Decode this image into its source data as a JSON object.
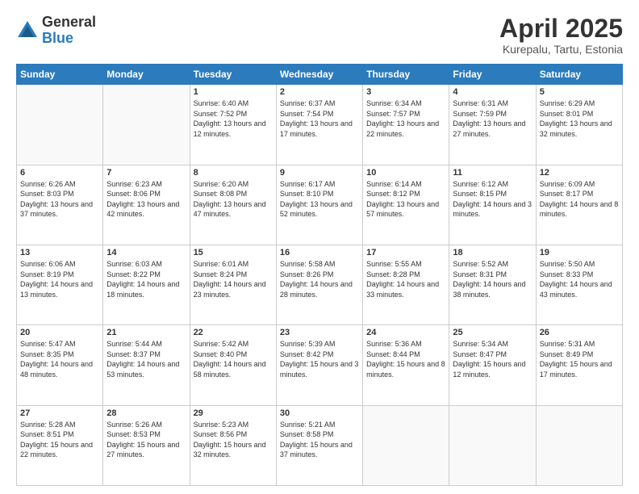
{
  "logo": {
    "general": "General",
    "blue": "Blue"
  },
  "title": "April 2025",
  "location": "Kurepalu, Tartu, Estonia",
  "days_of_week": [
    "Sunday",
    "Monday",
    "Tuesday",
    "Wednesday",
    "Thursday",
    "Friday",
    "Saturday"
  ],
  "weeks": [
    [
      {
        "day": "",
        "info": ""
      },
      {
        "day": "",
        "info": ""
      },
      {
        "day": "1",
        "info": "Sunrise: 6:40 AM\nSunset: 7:52 PM\nDaylight: 13 hours and 12 minutes."
      },
      {
        "day": "2",
        "info": "Sunrise: 6:37 AM\nSunset: 7:54 PM\nDaylight: 13 hours and 17 minutes."
      },
      {
        "day": "3",
        "info": "Sunrise: 6:34 AM\nSunset: 7:57 PM\nDaylight: 13 hours and 22 minutes."
      },
      {
        "day": "4",
        "info": "Sunrise: 6:31 AM\nSunset: 7:59 PM\nDaylight: 13 hours and 27 minutes."
      },
      {
        "day": "5",
        "info": "Sunrise: 6:29 AM\nSunset: 8:01 PM\nDaylight: 13 hours and 32 minutes."
      }
    ],
    [
      {
        "day": "6",
        "info": "Sunrise: 6:26 AM\nSunset: 8:03 PM\nDaylight: 13 hours and 37 minutes."
      },
      {
        "day": "7",
        "info": "Sunrise: 6:23 AM\nSunset: 8:06 PM\nDaylight: 13 hours and 42 minutes."
      },
      {
        "day": "8",
        "info": "Sunrise: 6:20 AM\nSunset: 8:08 PM\nDaylight: 13 hours and 47 minutes."
      },
      {
        "day": "9",
        "info": "Sunrise: 6:17 AM\nSunset: 8:10 PM\nDaylight: 13 hours and 52 minutes."
      },
      {
        "day": "10",
        "info": "Sunrise: 6:14 AM\nSunset: 8:12 PM\nDaylight: 13 hours and 57 minutes."
      },
      {
        "day": "11",
        "info": "Sunrise: 6:12 AM\nSunset: 8:15 PM\nDaylight: 14 hours and 3 minutes."
      },
      {
        "day": "12",
        "info": "Sunrise: 6:09 AM\nSunset: 8:17 PM\nDaylight: 14 hours and 8 minutes."
      }
    ],
    [
      {
        "day": "13",
        "info": "Sunrise: 6:06 AM\nSunset: 8:19 PM\nDaylight: 14 hours and 13 minutes."
      },
      {
        "day": "14",
        "info": "Sunrise: 6:03 AM\nSunset: 8:22 PM\nDaylight: 14 hours and 18 minutes."
      },
      {
        "day": "15",
        "info": "Sunrise: 6:01 AM\nSunset: 8:24 PM\nDaylight: 14 hours and 23 minutes."
      },
      {
        "day": "16",
        "info": "Sunrise: 5:58 AM\nSunset: 8:26 PM\nDaylight: 14 hours and 28 minutes."
      },
      {
        "day": "17",
        "info": "Sunrise: 5:55 AM\nSunset: 8:28 PM\nDaylight: 14 hours and 33 minutes."
      },
      {
        "day": "18",
        "info": "Sunrise: 5:52 AM\nSunset: 8:31 PM\nDaylight: 14 hours and 38 minutes."
      },
      {
        "day": "19",
        "info": "Sunrise: 5:50 AM\nSunset: 8:33 PM\nDaylight: 14 hours and 43 minutes."
      }
    ],
    [
      {
        "day": "20",
        "info": "Sunrise: 5:47 AM\nSunset: 8:35 PM\nDaylight: 14 hours and 48 minutes."
      },
      {
        "day": "21",
        "info": "Sunrise: 5:44 AM\nSunset: 8:37 PM\nDaylight: 14 hours and 53 minutes."
      },
      {
        "day": "22",
        "info": "Sunrise: 5:42 AM\nSunset: 8:40 PM\nDaylight: 14 hours and 58 minutes."
      },
      {
        "day": "23",
        "info": "Sunrise: 5:39 AM\nSunset: 8:42 PM\nDaylight: 15 hours and 3 minutes."
      },
      {
        "day": "24",
        "info": "Sunrise: 5:36 AM\nSunset: 8:44 PM\nDaylight: 15 hours and 8 minutes."
      },
      {
        "day": "25",
        "info": "Sunrise: 5:34 AM\nSunset: 8:47 PM\nDaylight: 15 hours and 12 minutes."
      },
      {
        "day": "26",
        "info": "Sunrise: 5:31 AM\nSunset: 8:49 PM\nDaylight: 15 hours and 17 minutes."
      }
    ],
    [
      {
        "day": "27",
        "info": "Sunrise: 5:28 AM\nSunset: 8:51 PM\nDaylight: 15 hours and 22 minutes."
      },
      {
        "day": "28",
        "info": "Sunrise: 5:26 AM\nSunset: 8:53 PM\nDaylight: 15 hours and 27 minutes."
      },
      {
        "day": "29",
        "info": "Sunrise: 5:23 AM\nSunset: 8:56 PM\nDaylight: 15 hours and 32 minutes."
      },
      {
        "day": "30",
        "info": "Sunrise: 5:21 AM\nSunset: 8:58 PM\nDaylight: 15 hours and 37 minutes."
      },
      {
        "day": "",
        "info": ""
      },
      {
        "day": "",
        "info": ""
      },
      {
        "day": "",
        "info": ""
      }
    ]
  ]
}
